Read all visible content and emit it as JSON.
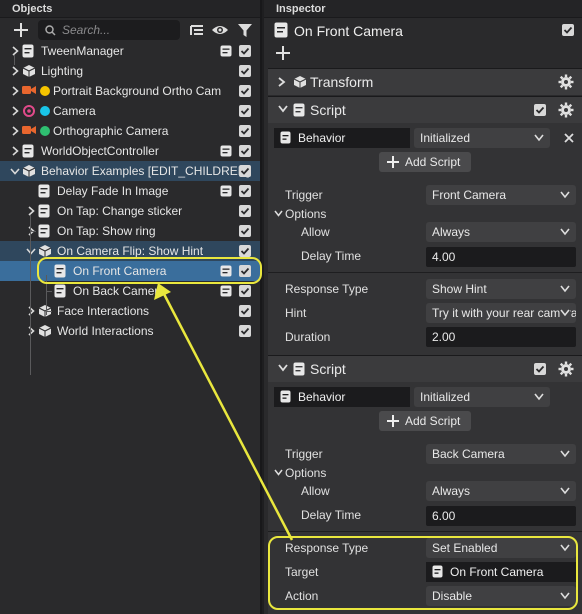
{
  "objects_panel": {
    "title": "Objects",
    "search_placeholder": "Search...",
    "tree": [
      {
        "label": "TweenManager",
        "icon": "script-icon"
      },
      {
        "label": "Lighting",
        "icon": "scene-object-icon"
      },
      {
        "label": "Portrait Background Ortho Cam",
        "icon": "camera-icon",
        "dot_color": "#f5c400"
      },
      {
        "label": "Camera",
        "icon": "camera-icon",
        "dot_color": "#19c5e8"
      },
      {
        "label": "Orthographic Camera",
        "icon": "camera-icon",
        "dot_color": "#2fbf71"
      },
      {
        "label": "WorldObjectController",
        "icon": "script-icon"
      },
      {
        "label": "Behavior Examples [EDIT_CHILDREN]",
        "icon": "scene-object-icon"
      },
      {
        "label": "Delay Fade In Image",
        "icon": "script-icon"
      },
      {
        "label": "On Tap: Change sticker",
        "icon": "script-icon"
      },
      {
        "label": "On Tap: Show ring",
        "icon": "script-icon"
      },
      {
        "label": "On Camera Flip: Show Hint",
        "icon": "scene-object-icon"
      },
      {
        "label": "On Front Camera",
        "icon": "script-icon"
      },
      {
        "label": "On Back Camera",
        "icon": "script-icon"
      },
      {
        "label": "Face Interactions",
        "icon": "scene-object-icon"
      },
      {
        "label": "World Interactions",
        "icon": "scene-object-icon"
      }
    ]
  },
  "inspector": {
    "title": "Inspector",
    "object_name": "On Front Camera",
    "transform_label": "Transform",
    "script1": {
      "title": "Script",
      "behavior": "Behavior",
      "status": "Initialized",
      "add_script": "Add Script",
      "trigger_label": "Trigger",
      "trigger_value": "Front Camera",
      "options_label": "Options",
      "allow_label": "Allow",
      "allow_value": "Always",
      "delay_label": "Delay Time",
      "delay_value": "4.00",
      "response_label": "Response Type",
      "response_value": "Show Hint",
      "hint_label": "Hint",
      "hint_value": "Try it with your rear camera",
      "duration_label": "Duration",
      "duration_value": "2.00"
    },
    "script2": {
      "title": "Script",
      "behavior": "Behavior",
      "status": "Initialized",
      "add_script": "Add Script",
      "trigger_label": "Trigger",
      "trigger_value": "Back Camera",
      "options_label": "Options",
      "allow_label": "Allow",
      "allow_value": "Always",
      "delay_label": "Delay Time",
      "delay_value": "6.00",
      "response_label": "Response Type",
      "response_value": "Set Enabled",
      "target_label": "Target",
      "target_value": "On Front Camera",
      "action_label": "Action",
      "action_value": "Disable"
    }
  },
  "colors": {
    "selection": "#3a6e9c",
    "highlight": "#e9e73e"
  }
}
